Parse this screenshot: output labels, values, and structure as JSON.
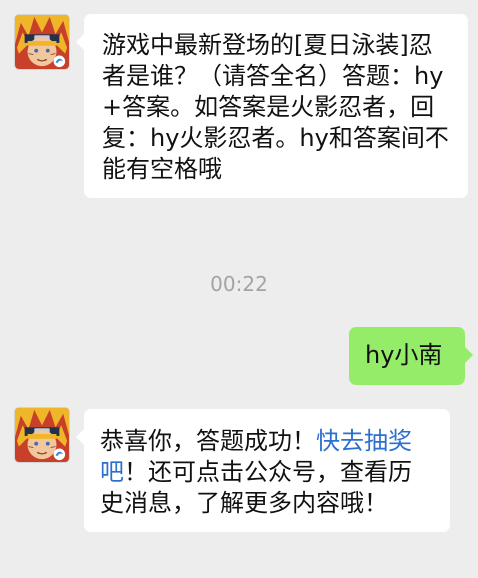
{
  "chat": {
    "messages": [
      {
        "sender": "official-account",
        "text": "游戏中最新登场的[夏日泳装]忍者是谁？（请答全名）答题：hy+答案。如答案是火影忍者，回复：hy火影忍者。hy和答案间不能有空格哦"
      },
      {
        "sender": "me",
        "text": "hy小南"
      },
      {
        "sender": "official-account",
        "text_before": "恭喜你，答题成功！",
        "link_text": "快去抽奖吧",
        "text_after": "！还可点击公众号，查看历史消息，了解更多内容哦！"
      }
    ],
    "timestamp": "00:22"
  },
  "colors": {
    "background": "#ededed",
    "incoming_bubble": "#ffffff",
    "outgoing_bubble": "#95ec69",
    "link": "#2b6fcf",
    "timestamp": "#a3a3a3"
  },
  "icons": {
    "avatar": "ninja-avatar-icon"
  }
}
